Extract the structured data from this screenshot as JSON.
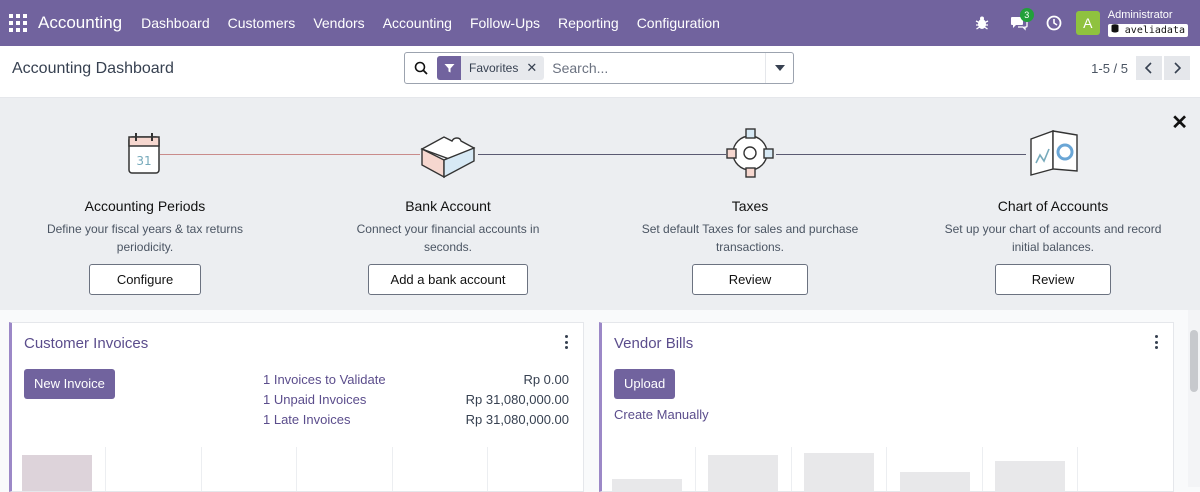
{
  "navbar": {
    "app_title": "Accounting",
    "menu": [
      "Dashboard",
      "Customers",
      "Vendors",
      "Accounting",
      "Follow-Ups",
      "Reporting",
      "Configuration"
    ],
    "messages_count": "3",
    "avatar_letter": "A",
    "user_name": "Administrator",
    "db_name": "aveliadata",
    "bg_color": "#71639e"
  },
  "control": {
    "page_title": "Accounting Dashboard",
    "facet_label": "Favorites",
    "search_placeholder": "Search...",
    "pager": "1-5 / 5"
  },
  "onboarding": {
    "steps": [
      {
        "title": "Accounting Periods",
        "desc": "Define your fiscal years & tax returns periodicity.",
        "button": "Configure",
        "icon": "calendar-icon"
      },
      {
        "title": "Bank Account",
        "desc": "Connect your financial accounts in seconds.",
        "button": "Add a bank account",
        "icon": "puzzle-icon"
      },
      {
        "title": "Taxes",
        "desc": "Set default Taxes for sales and purchase transactions.",
        "button": "Review",
        "icon": "gear-icon"
      },
      {
        "title": "Chart of Accounts",
        "desc": "Set up your chart of accounts and record initial balances.",
        "button": "Review",
        "icon": "chart-icon"
      }
    ]
  },
  "customer_invoices": {
    "title": "Customer Invoices",
    "primary_button": "New Invoice",
    "stats": [
      {
        "label": "1 Invoices to Validate",
        "amount": "Rp 0.00"
      },
      {
        "label": "1 Unpaid Invoices",
        "amount": "Rp 31,080,000.00"
      },
      {
        "label": "1 Late Invoices",
        "amount": "Rp 31,080,000.00"
      }
    ]
  },
  "vendor_bills": {
    "title": "Vendor Bills",
    "primary_button": "Upload",
    "secondary_link": "Create Manually"
  }
}
